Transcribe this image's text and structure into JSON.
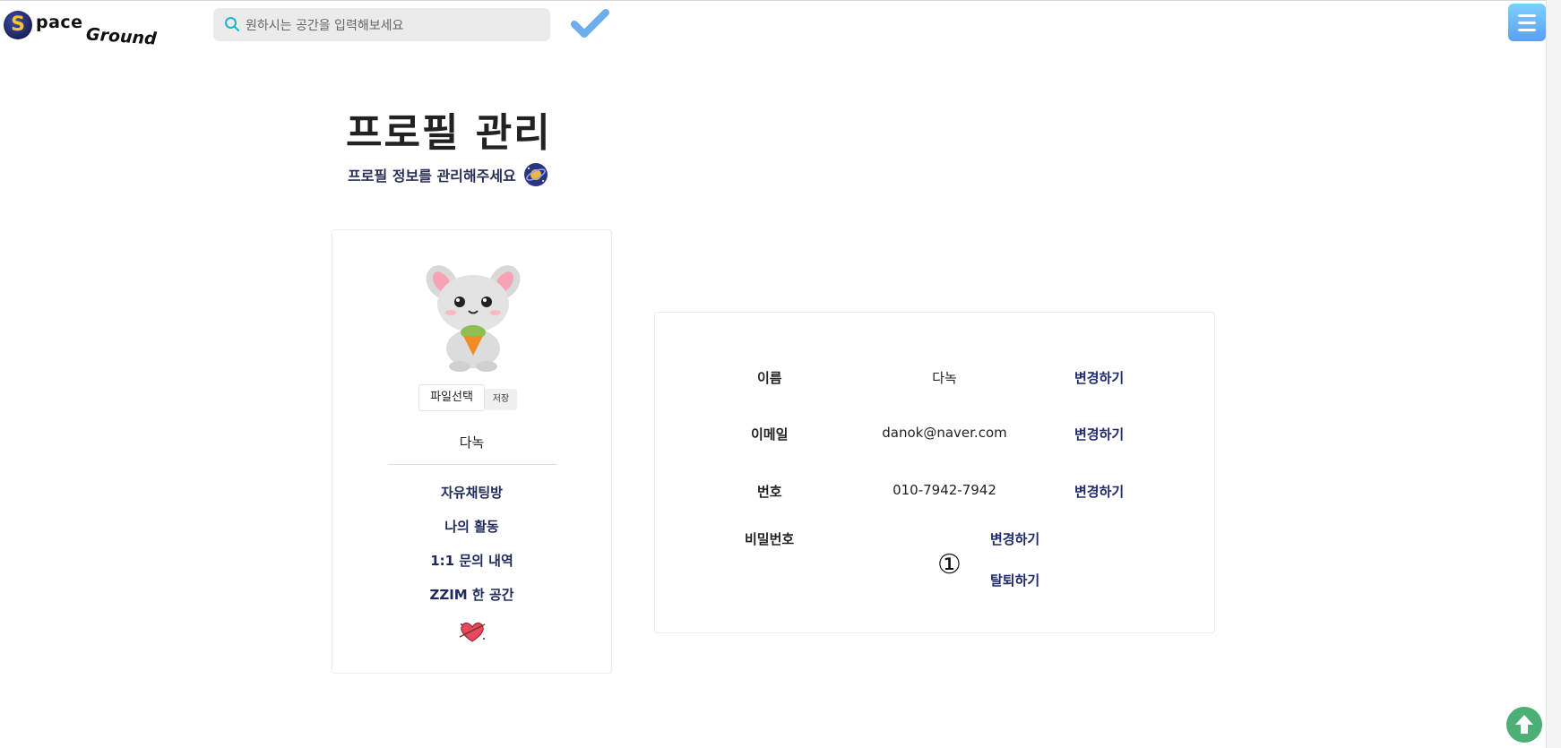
{
  "header": {
    "logo_s": "S",
    "logo_space": "pace",
    "logo_ground": "Ground",
    "search_placeholder": "원하시는 공간을 입력해보세요"
  },
  "page": {
    "title": "프로필 관리",
    "subtitle": "프로필 정보를 관리해주세요"
  },
  "sidebar": {
    "file_button": "파일선택",
    "save_button": "저장",
    "nickname": "다녹",
    "links": [
      "자유채팅방",
      "나의 활동",
      "1:1 문의 내역",
      "ZZIM 한 공간"
    ]
  },
  "profile": {
    "rows": [
      {
        "label": "이름",
        "value": "다녹",
        "action": "변경하기"
      },
      {
        "label": "이메일",
        "value": "danok@naver.com",
        "action": "변경하기"
      },
      {
        "label": "번호",
        "value": "010-7942-7942",
        "action": "변경하기"
      }
    ],
    "password_label": "비밀번호",
    "password_action": "변경하기",
    "withdraw_action": "탈퇴하기",
    "marker": "①"
  },
  "icons": {
    "search": "search-icon",
    "confirm": "check-icon",
    "menu": "hamburger-menu-icon",
    "scroll_top": "arrow-up-icon",
    "planet": "planet-icon",
    "heart": "heart-icon",
    "avatar": "bunny-avatar"
  },
  "colors": {
    "accent_blue": "#5aa0f5",
    "link_navy": "#1f2a6a",
    "scroll_top_green": "#4caf73"
  }
}
